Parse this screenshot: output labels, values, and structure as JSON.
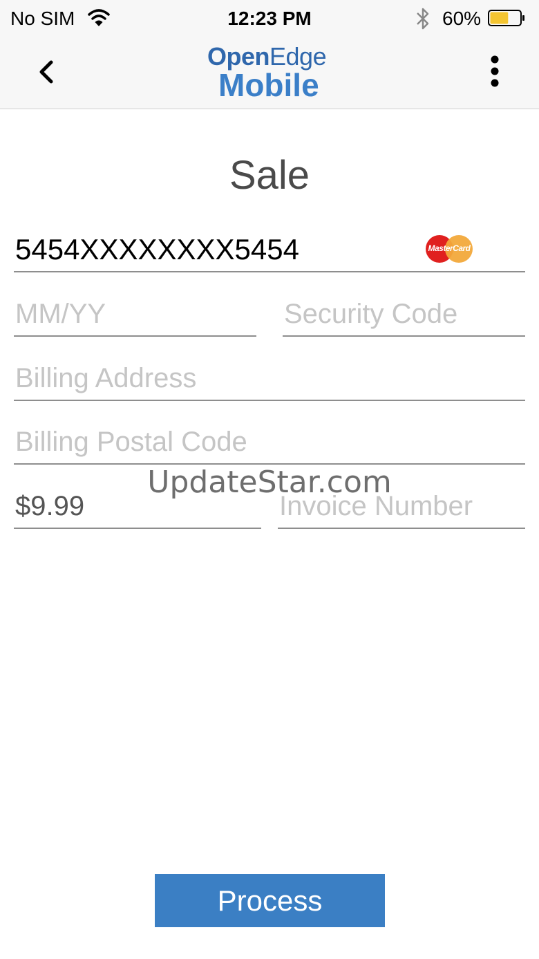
{
  "status_bar": {
    "carrier": "No SIM",
    "time": "12:23 PM",
    "battery_percent": "60%",
    "battery_level": 0.6,
    "icons": [
      "wifi-icon",
      "bluetooth-icon",
      "battery-icon"
    ]
  },
  "nav": {
    "back_icon": "chevron-left-icon",
    "menu_icon": "more-vertical-icon",
    "logo": {
      "line1_bold": "Open",
      "line1_regular": "Edge",
      "line2": "Mobile"
    }
  },
  "page": {
    "title": "Sale"
  },
  "form": {
    "card_number": {
      "value": "5454XXXXXXXX5454",
      "placeholder": ""
    },
    "card_brand": "MasterCard",
    "expiry": {
      "value": "",
      "placeholder": "MM/YY"
    },
    "security_code": {
      "value": "",
      "placeholder": "Security Code"
    },
    "billing_address": {
      "value": "",
      "placeholder": "Billing Address"
    },
    "billing_postal_code": {
      "value": "",
      "placeholder": "Billing Postal Code"
    },
    "amount": {
      "value": "$9.99",
      "placeholder": ""
    },
    "invoice_number": {
      "value": "",
      "placeholder": "Invoice Number"
    }
  },
  "watermark": "UpdateStar.com",
  "actions": {
    "process_label": "Process"
  },
  "colors": {
    "brand_blue": "#3b7fc4",
    "logo_blue": "#2f67ac",
    "mastercard_red": "#e0201f",
    "mastercard_orange": "#f2a93b",
    "battery_yellow": "#f4c531"
  }
}
